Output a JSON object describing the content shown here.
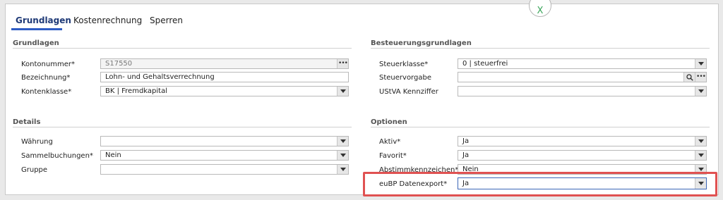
{
  "tabs": [
    {
      "label": "Grundlagen"
    },
    {
      "label": "Kostenrechnung"
    },
    {
      "label": "Sperren"
    }
  ],
  "top_right_mark": "X",
  "left": {
    "section1_title": "Grundlagen",
    "kontonummer": {
      "label": "Kontonummer*",
      "value": "S17550"
    },
    "bezeichnung": {
      "label": "Bezeichnung*",
      "value": "Lohn- und Gehaltsverrechnung"
    },
    "kontenklasse": {
      "label": "Kontenklasse*",
      "value": "BK  |  Fremdkapital"
    },
    "section2_title": "Details",
    "waehrung": {
      "label": "Währung",
      "value": ""
    },
    "sammelbuchungen": {
      "label": "Sammelbuchungen*",
      "value": "Nein"
    },
    "gruppe": {
      "label": "Gruppe",
      "value": ""
    }
  },
  "right": {
    "section1_title": "Besteuerungsgrundlagen",
    "steuerklasse": {
      "label": "Steuerklasse*",
      "value": "0  |  steuerfrei"
    },
    "steuervorgabe": {
      "label": "Steuervorgabe",
      "value": ""
    },
    "ustva": {
      "label": "UStVA Kennziffer",
      "value": ""
    },
    "section2_title": "Optionen",
    "aktiv": {
      "label": "Aktiv*",
      "value": "Ja"
    },
    "favorit": {
      "label": "Favorit*",
      "value": "Ja"
    },
    "abstimm": {
      "label": "Abstimmkennzeichen*",
      "value": "Nein"
    },
    "eubp": {
      "label": "euBP Datenexport*",
      "value": "Ja"
    }
  },
  "colors": {
    "accent": "#2e5cc4",
    "highlight": "#e05252"
  },
  "icons": {
    "dropdown": "chevron-down-icon",
    "more": "ellipsis-icon",
    "search": "search-icon"
  }
}
